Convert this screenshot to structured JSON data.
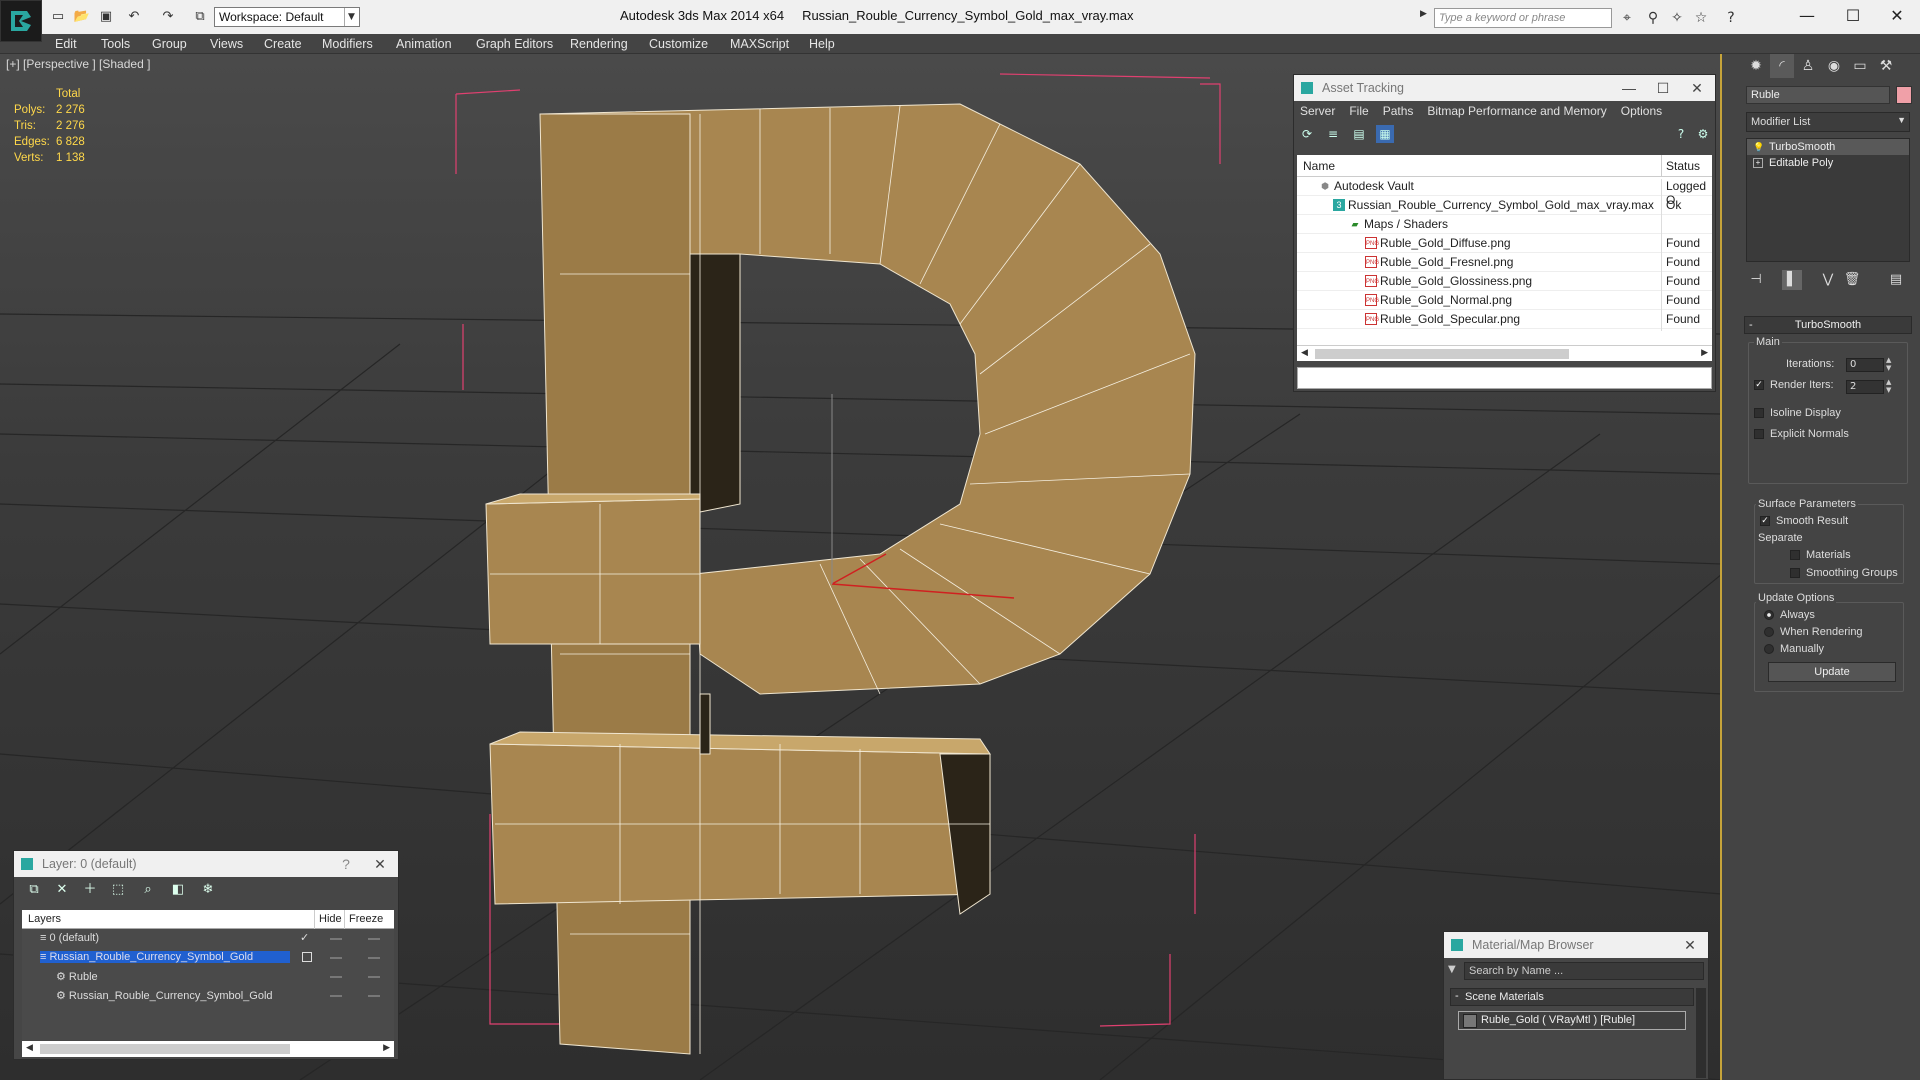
{
  "titlebar": {
    "workspace": "Workspace: Default",
    "app_name": "Autodesk 3ds Max  2014 x64",
    "file_name": "Russian_Rouble_Currency_Symbol_Gold_max_vray.max",
    "search_placeholder": "Type a keyword or phrase"
  },
  "menu": [
    "Edit",
    "Tools",
    "Group",
    "Views",
    "Create",
    "Modifiers",
    "Animation",
    "Graph Editors",
    "Rendering",
    "Customize",
    "MAXScript",
    "Help"
  ],
  "viewport": {
    "label": "[+] [Perspective ] [Shaded ]",
    "stats": {
      "total_label": "Total",
      "rows": [
        {
          "label": "Polys:",
          "value": "2 276"
        },
        {
          "label": "Tris:",
          "value": "2 276"
        },
        {
          "label": "Edges:",
          "value": "6 828"
        },
        {
          "label": "Verts:",
          "value": "1 138"
        }
      ]
    },
    "model_color": "#a88650"
  },
  "asset_tracking": {
    "title": "Asset Tracking",
    "menu": [
      "Server",
      "File",
      "Paths",
      "Bitmap Performance and Memory",
      "Options"
    ],
    "columns": {
      "name": "Name",
      "status": "Status"
    },
    "rows": [
      {
        "name": "Autodesk Vault",
        "status": "Logged O",
        "indent": 1,
        "icon": "vault-icon"
      },
      {
        "name": "Russian_Rouble_Currency_Symbol_Gold_max_vray.max",
        "status": "Ok",
        "indent": 2,
        "icon": "max-file-icon"
      },
      {
        "name": "Maps / Shaders",
        "status": "",
        "indent": 3,
        "icon": "folder-icon"
      },
      {
        "name": "Ruble_Gold_Diffuse.png",
        "status": "Found",
        "indent": 4,
        "icon": "png-icon"
      },
      {
        "name": "Ruble_Gold_Fresnel.png",
        "status": "Found",
        "indent": 4,
        "icon": "png-icon"
      },
      {
        "name": "Ruble_Gold_Glossiness.png",
        "status": "Found",
        "indent": 4,
        "icon": "png-icon"
      },
      {
        "name": "Ruble_Gold_Normal.png",
        "status": "Found",
        "indent": 4,
        "icon": "png-icon"
      },
      {
        "name": "Ruble_Gold_Specular.png",
        "status": "Found",
        "indent": 4,
        "icon": "png-icon"
      }
    ]
  },
  "command_panel": {
    "object_name": "Ruble",
    "object_color": "#f0a0a8",
    "modifier_list": "Modifier List",
    "stack": [
      "TurboSmooth",
      "Editable Poly"
    ],
    "turbosmooth": {
      "title": "TurboSmooth",
      "main": "Main",
      "iterations_label": "Iterations:",
      "iterations_value": "0",
      "render_iters_label": "Render Iters:",
      "render_iters_value": "2",
      "isoline": "Isoline Display",
      "explicit": "Explicit Normals",
      "surface": "Surface Parameters",
      "smooth_result": "Smooth Result",
      "separate": "Separate",
      "materials": "Materials",
      "smoothing_groups": "Smoothing Groups",
      "update_options": "Update Options",
      "always": "Always",
      "when_rendering": "When Rendering",
      "manually": "Manually",
      "update": "Update"
    }
  },
  "layer_window": {
    "title": "Layer: 0 (default)",
    "help": "?",
    "columns": {
      "layers": "Layers",
      "hide": "Hide",
      "freeze": "Freeze"
    },
    "rows": [
      {
        "name": "0 (default)",
        "selected": false
      },
      {
        "name": "Russian_Rouble_Currency_Symbol_Gold",
        "selected": true
      },
      {
        "name": "Ruble",
        "selected": false
      },
      {
        "name": "Russian_Rouble_Currency_Symbol_Gold",
        "selected": false
      }
    ]
  },
  "material_browser": {
    "title": "Material/Map Browser",
    "search_placeholder": "Search by Name ...",
    "group": "Scene Materials",
    "item": "Ruble_Gold  ( VRayMtl )  [Ruble]"
  }
}
